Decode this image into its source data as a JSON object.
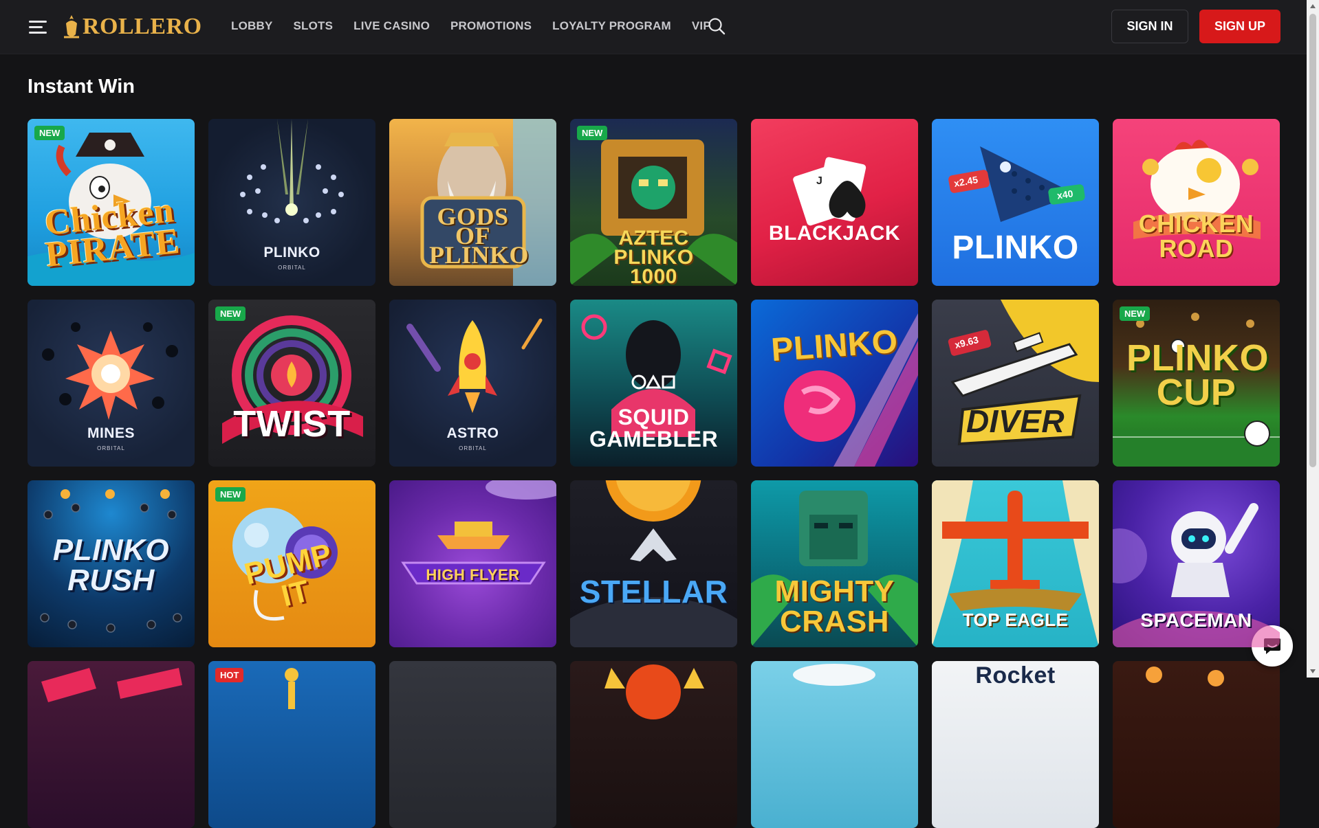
{
  "header": {
    "brand": "ROLLERO",
    "nav": [
      "LOBBY",
      "SLOTS",
      "LIVE CASINO",
      "PROMOTIONS",
      "LOYALTY PROGRAM",
      "VIP"
    ],
    "signin": "SIGN IN",
    "signup": "SIGN UP",
    "accent": "#d7191a",
    "brand_color": "#e9b24a"
  },
  "section": {
    "title": "Instant Win"
  },
  "games": [
    {
      "title": "Chicken PIRATE",
      "sub": "",
      "badge": "NEW"
    },
    {
      "title": "PLINKO",
      "sub": "ORBITAL",
      "badge": ""
    },
    {
      "title": "GODS OF PLINKO",
      "sub": "",
      "badge": ""
    },
    {
      "title": "AZTEC PLINKO 1000",
      "sub": "",
      "badge": "NEW"
    },
    {
      "title": "BLACKJACK",
      "sub": "",
      "badge": ""
    },
    {
      "title": "PLINKO",
      "sub": "",
      "badge": ""
    },
    {
      "title": "CHICKEN ROAD",
      "sub": "",
      "badge": ""
    },
    {
      "title": "MINES",
      "sub": "ORBITAL",
      "badge": ""
    },
    {
      "title": "TWIST",
      "sub": "",
      "badge": "NEW"
    },
    {
      "title": "ASTRO",
      "sub": "ORBITAL",
      "badge": ""
    },
    {
      "title": "SQUID GAMEBLER",
      "sub": "",
      "badge": ""
    },
    {
      "title": "PLINKO",
      "sub": "",
      "badge": ""
    },
    {
      "title": "DIVER",
      "sub": "",
      "badge": ""
    },
    {
      "title": "PLINKO CUP",
      "sub": "",
      "badge": "NEW"
    },
    {
      "title": "PLINKO RUSH",
      "sub": "",
      "badge": ""
    },
    {
      "title": "PUMP IT",
      "sub": "",
      "badge": "NEW"
    },
    {
      "title": "HIGH FLYER",
      "sub": "",
      "badge": ""
    },
    {
      "title": "STELLAR",
      "sub": "",
      "badge": ""
    },
    {
      "title": "MIGHTY CRASH",
      "sub": "",
      "badge": ""
    },
    {
      "title": "TOP EAGLE",
      "sub": "",
      "badge": ""
    },
    {
      "title": "SPACEMAN",
      "sub": "",
      "badge": ""
    },
    {
      "title": "",
      "sub": "",
      "badge": ""
    },
    {
      "title": "",
      "sub": "",
      "badge": "HOT"
    },
    {
      "title": "",
      "sub": "",
      "badge": ""
    },
    {
      "title": "",
      "sub": "",
      "badge": ""
    },
    {
      "title": "",
      "sub": "",
      "badge": ""
    },
    {
      "title": "Rocket",
      "sub": "",
      "badge": ""
    },
    {
      "title": "",
      "sub": "",
      "badge": ""
    }
  ],
  "labels": {
    "x245": "x2.45",
    "x40": "x40",
    "x963": "x9.63"
  },
  "icons": [
    "menu-icon",
    "logo-icon",
    "search-icon",
    "chat-icon"
  ]
}
